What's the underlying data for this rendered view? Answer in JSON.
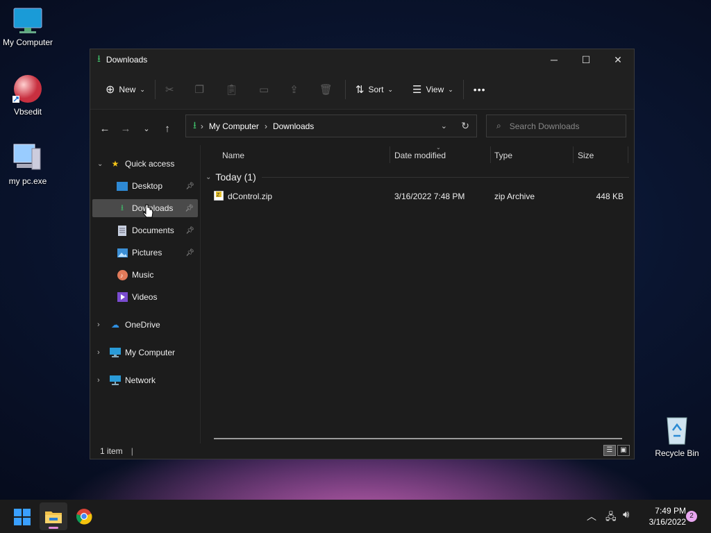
{
  "desktop": {
    "icons": [
      {
        "label": "My Computer"
      },
      {
        "label": "Vbsedit"
      },
      {
        "label": "my pc.exe"
      },
      {
        "label": "Recycle Bin"
      }
    ]
  },
  "window": {
    "title": "Downloads",
    "toolbar": {
      "new_label": "New",
      "sort_label": "Sort",
      "view_label": "View",
      "more_label": "•••"
    },
    "address": {
      "crumbs": [
        "My Computer",
        "Downloads"
      ]
    },
    "search": {
      "placeholder": "Search Downloads"
    },
    "sidebar": {
      "quick_access": "Quick access",
      "items": [
        "Desktop",
        "Downloads",
        "Documents",
        "Pictures",
        "Music",
        "Videos"
      ],
      "onedrive": "OneDrive",
      "my_computer": "My Computer",
      "network": "Network"
    },
    "columns": [
      "Name",
      "Date modified",
      "Type",
      "Size"
    ],
    "group_label": "Today (1)",
    "files": [
      {
        "name": "dControl.zip",
        "date": "3/16/2022 7:48 PM",
        "type": "zip Archive",
        "size": "448 KB"
      }
    ],
    "status": "1 item"
  },
  "taskbar": {
    "time": "7:49 PM",
    "date": "3/16/2022",
    "badge": "2"
  },
  "colors": {
    "accent": "#0078d4",
    "download_green": "#3fbf6a"
  }
}
